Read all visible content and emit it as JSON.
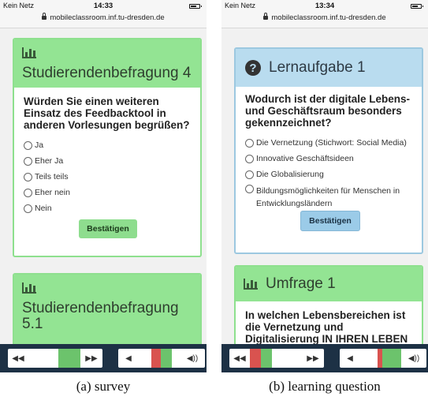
{
  "panel_a": {
    "status": {
      "carrier": "Kein Netz",
      "time": "14:33",
      "url": "mobileclassroom.inf.tu-dresden.de"
    },
    "card1": {
      "title": "Studierendenbefragung 4",
      "question": "Würden Sie einen weiteren Einsatz des Feedbacktool in anderen Vorlesungen begrüßen?",
      "options": [
        "Ja",
        "Eher Ja",
        "Teils teils",
        "Eher nein",
        "Nein"
      ],
      "button": "Bestätigen"
    },
    "card2": {
      "title": "Studierendenbefragung 5.1"
    },
    "toolbar": {
      "rewind": "◀◀",
      "forward": "▶▶",
      "vol_down": "◀",
      "vol_up": "◀))"
    },
    "caption": "(a)  survey"
  },
  "panel_b": {
    "status": {
      "carrier": "Kein Netz",
      "time": "13:34",
      "url": "mobileclassroom.inf.tu-dresden.de"
    },
    "card1": {
      "title": "Lernaufgabe 1",
      "question": "Wodurch ist der digitale Lebens- und Geschäftsraum besonders gekennzeichnet?",
      "options": [
        "Die Vernetzung (Stichwort: Social Media)",
        "Innovative Geschäftsideen",
        "Die Globalisierung",
        "Bildungsmöglichkeiten für Menschen in Entwicklungsländern"
      ],
      "button": "Bestätigen"
    },
    "card2": {
      "title": "Umfrage 1",
      "question": "In welchen Lebensbereichen ist die Vernetzung und Digitalisierung IN IHREN LEBEN"
    },
    "toolbar": {
      "rewind": "◀◀",
      "forward": "▶▶",
      "vol_down": "◀",
      "vol_up": "◀))"
    },
    "caption": "(b)  learning question"
  },
  "colors": {
    "green_header": "#93e493",
    "blue_header": "#b9dcef",
    "toolbar": "#1d3145",
    "green_seg": "#6cc36c",
    "red_seg": "#d9534f"
  }
}
